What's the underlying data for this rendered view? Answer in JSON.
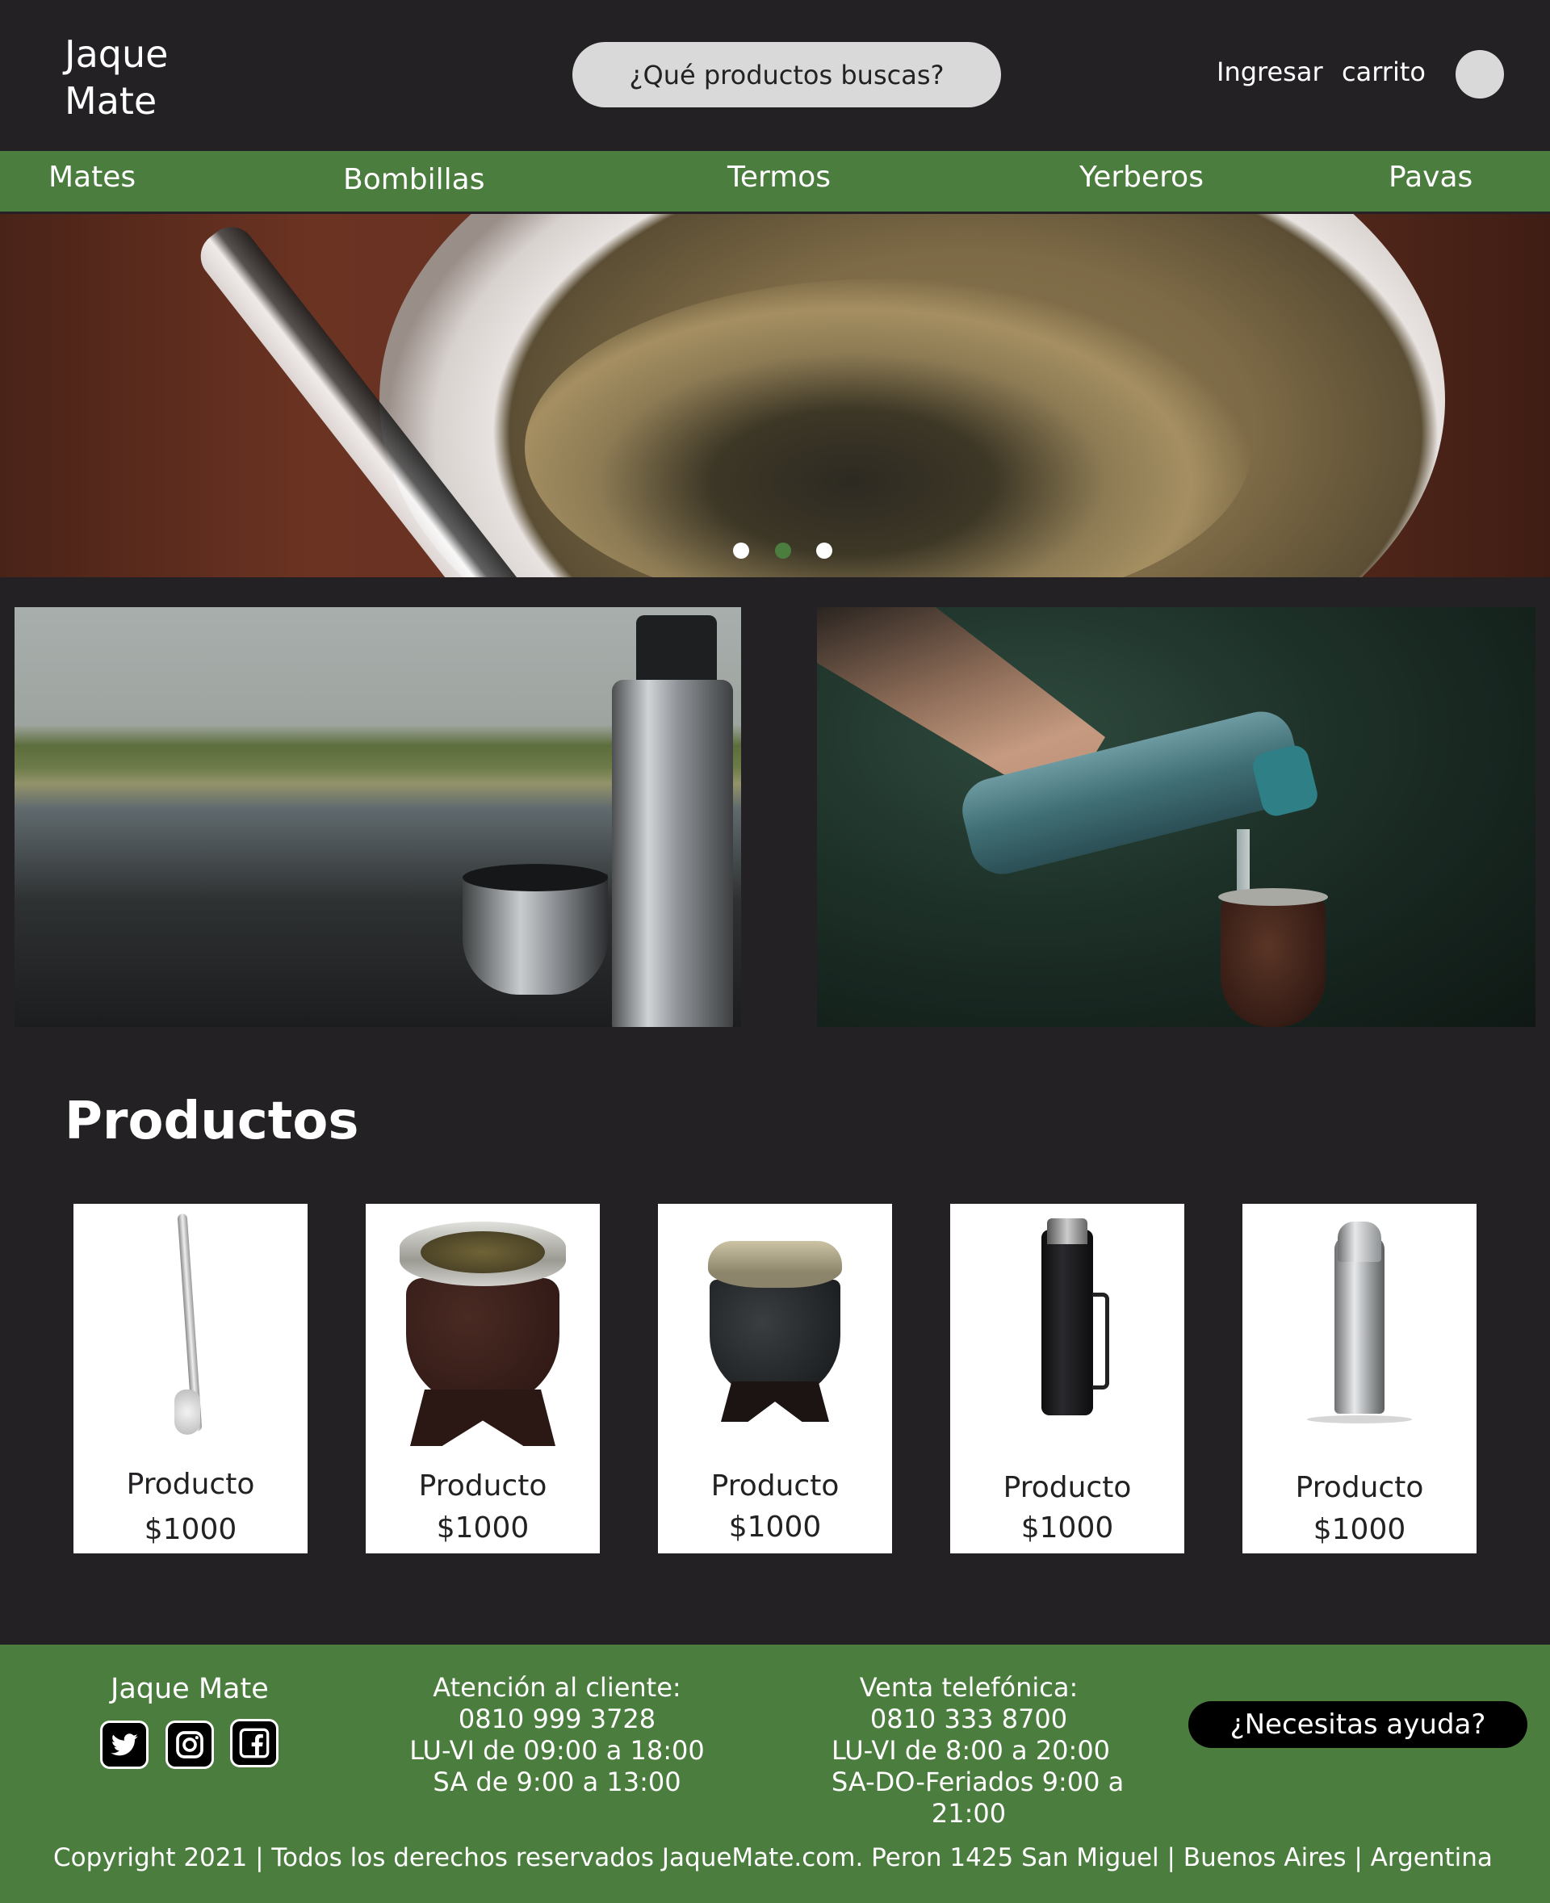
{
  "header": {
    "logo": "Jaque Mate",
    "search_placeholder": "¿Qué productos buscas?",
    "login_label": "Ingresar",
    "cart_label": "carrito"
  },
  "nav": {
    "items": [
      "Mates",
      "Bombillas",
      "Termos",
      "Yerberos",
      "Pavas"
    ]
  },
  "carousel": {
    "slides": 3,
    "active_slide": 2
  },
  "products": {
    "title": "Productos",
    "items": [
      {
        "name": "Producto",
        "price": "$1000",
        "icon": "bombilla-icon"
      },
      {
        "name": "Producto",
        "price": "$1000",
        "icon": "mate-gourd-icon"
      },
      {
        "name": "Producto",
        "price": "$1000",
        "icon": "mate-gourd-icon"
      },
      {
        "name": "Producto",
        "price": "$1000",
        "icon": "thermos-icon"
      },
      {
        "name": "Producto",
        "price": "$1000",
        "icon": "thermos-icon"
      }
    ]
  },
  "footer": {
    "brand": "Jaque Mate",
    "social": [
      "twitter-icon",
      "instagram-icon",
      "facebook-icon"
    ],
    "customer_service": {
      "title": "Atención al cliente:",
      "phone": "0810 999 3728",
      "hours_weekday": "LU-VI de 09:00 a 18:00",
      "hours_saturday": "SA de 9:00 a 13:00"
    },
    "phone_sales": {
      "title": "Venta telefónica:",
      "phone": "0810 333 8700",
      "hours_weekday": "LU-VI de 8:00 a 20:00",
      "hours_weekend_line1": "SA-DO-Feriados 9:00 a",
      "hours_weekend_line2": "21:00"
    },
    "help_button": "¿Necesitas ayuda?",
    "copyright": "Copyright 2021 | Todos los derechos reservados JaqueMate.com. Peron 1425 San Miguel | Buenos Aires | Argentina"
  },
  "colors": {
    "background": "#232123",
    "accent_green": "#4b7d3e",
    "search_bg": "#d9d9d9"
  }
}
